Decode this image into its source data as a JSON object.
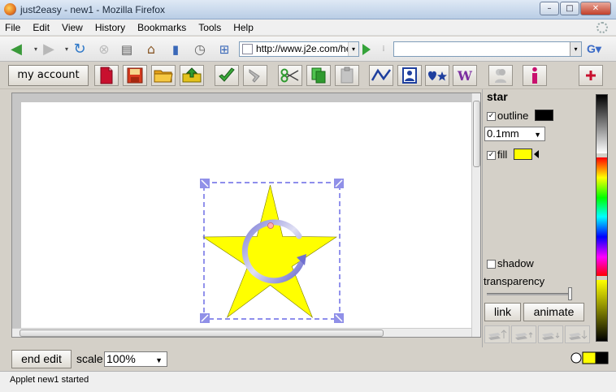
{
  "window": {
    "title": "just2easy - new1 - Mozilla Firefox"
  },
  "menubar": {
    "items": [
      "File",
      "Edit",
      "View",
      "History",
      "Bookmarks",
      "Tools",
      "Help"
    ]
  },
  "navbar": {
    "url": "http://www.j2e.com/he",
    "search_value": ""
  },
  "apptoolbar": {
    "my_account_label": "my account",
    "icons": [
      "new-document-icon",
      "save-icon",
      "open-folder-icon",
      "upload-icon",
      "tick-icon",
      "redo-icon",
      "scissors-icon",
      "copy-icon",
      "paste-icon",
      "line-tool-icon",
      "image-tool-icon",
      "symbols-icon",
      "word-art-icon",
      "person-icon",
      "info-icon",
      "add-icon"
    ],
    "colors": {
      "accent_red": "#c8102e",
      "accent_green": "#2f9a2f",
      "accent_blue": "#1e3f9e"
    }
  },
  "canvas": {
    "shape_fill": "#ffff00",
    "shape_outline": "#000000",
    "selection_color": "#4b4be0"
  },
  "properties": {
    "title": "star",
    "outline_label": "outline",
    "outline_checked": true,
    "outline_color": "#000000",
    "line_width": "0.1mm",
    "fill_label": "fill",
    "fill_checked": true,
    "fill_color": "#ffff00",
    "shadow_label": "shadow",
    "shadow_checked": false,
    "transparency_label": "transparency",
    "transparency_level": 1.0,
    "link_label": "link",
    "animate_label": "animate"
  },
  "bottombar": {
    "end_edit_label": "end edit",
    "scale_label": "scale",
    "scale_value": "100%"
  },
  "statusbar": {
    "text": "Applet new1 started"
  }
}
